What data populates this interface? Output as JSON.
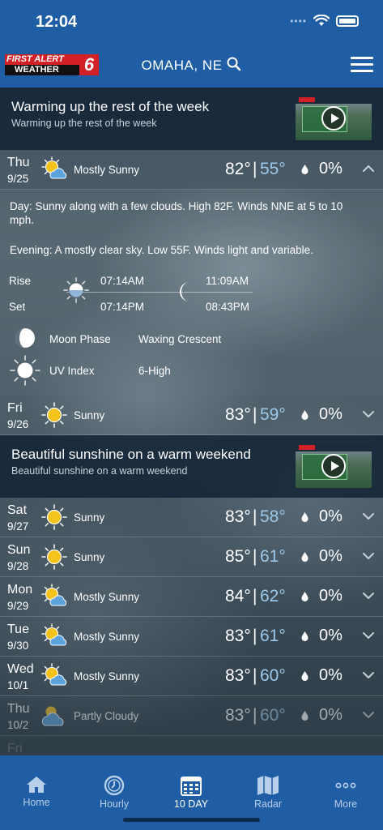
{
  "status_bar": {
    "time": "12:04"
  },
  "header": {
    "logo_line1": "FIRST ALERT",
    "logo_line2": "WEATHER",
    "logo_channel": "6",
    "location": "OMAHA, NE"
  },
  "video_cards": [
    {
      "title": "Warming up the rest of the week",
      "subtitle": "Warming up the rest of the week"
    },
    {
      "title": "Beautiful sunshine on a warm weekend",
      "subtitle": "Beautiful sunshine on a warm weekend"
    }
  ],
  "days": [
    {
      "day": "Thu",
      "date": "9/25",
      "condition": "Mostly Sunny",
      "icon": "mostly-sunny-icon",
      "high": "82°",
      "low": "55°",
      "precip": "0%",
      "expanded": true
    },
    {
      "day": "Fri",
      "date": "9/26",
      "condition": "Sunny",
      "icon": "sunny-icon",
      "high": "83°",
      "low": "59°",
      "precip": "0%",
      "expanded": false
    },
    {
      "day": "Sat",
      "date": "9/27",
      "condition": "Sunny",
      "icon": "sunny-icon",
      "high": "83°",
      "low": "58°",
      "precip": "0%",
      "expanded": false
    },
    {
      "day": "Sun",
      "date": "9/28",
      "condition": "Sunny",
      "icon": "sunny-icon",
      "high": "85°",
      "low": "61°",
      "precip": "0%",
      "expanded": false
    },
    {
      "day": "Mon",
      "date": "9/29",
      "condition": "Mostly Sunny",
      "icon": "mostly-sunny-icon",
      "high": "84°",
      "low": "62°",
      "precip": "0%",
      "expanded": false
    },
    {
      "day": "Tue",
      "date": "9/30",
      "condition": "Mostly Sunny",
      "icon": "mostly-sunny-icon",
      "high": "83°",
      "low": "61°",
      "precip": "0%",
      "expanded": false
    },
    {
      "day": "Wed",
      "date": "10/1",
      "condition": "Mostly Sunny",
      "icon": "mostly-sunny-icon",
      "high": "83°",
      "low": "60°",
      "precip": "0%",
      "expanded": false
    },
    {
      "day": "Thu",
      "date": "10/2",
      "condition": "Partly Cloudy",
      "icon": "partly-cloudy-icon",
      "high": "83°",
      "low": "60°",
      "precip": "0%",
      "expanded": false
    },
    {
      "day": "Fri",
      "date": "",
      "condition": "",
      "icon": "",
      "high": "",
      "low": "",
      "precip": "",
      "expanded": false
    }
  ],
  "details": {
    "day_label": "Day",
    "day_text": ": Sunny along with a few clouds. High 82F. Winds NNE at 5 to 10 mph.",
    "evening_label": "Evening",
    "evening_text": ": A mostly clear sky. Low 55F. Winds light and variable.",
    "rise_label": "Rise",
    "set_label": "Set",
    "sunrise": "07:14AM",
    "sunset": "07:14PM",
    "moonrise": "11:09AM",
    "moonset": "08:43PM",
    "moon_phase_label": "Moon Phase",
    "moon_phase_value": "Waxing Crescent",
    "uv_label": "UV Index",
    "uv_value": "6-High"
  },
  "nav": [
    {
      "label": "Home",
      "icon": "home-icon"
    },
    {
      "label": "Hourly",
      "icon": "clock-icon"
    },
    {
      "label": "10 DAY",
      "icon": "calendar-icon",
      "active": true
    },
    {
      "label": "Radar",
      "icon": "map-icon"
    },
    {
      "label": "More",
      "icon": "more-dots-icon"
    }
  ],
  "colors": {
    "header_blue": "#1f5da4",
    "low_temp": "#9cc8ea",
    "logo_red": "#d32027"
  }
}
